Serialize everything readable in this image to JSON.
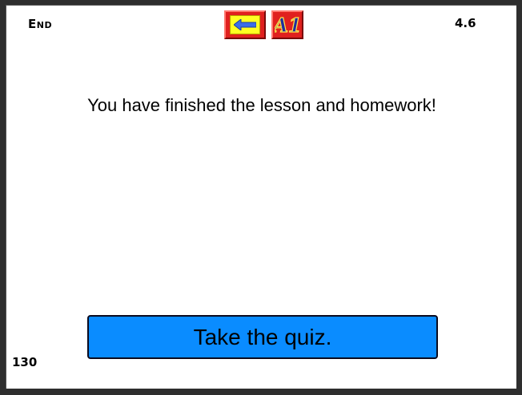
{
  "header": {
    "section_label": "End",
    "version": "4.6"
  },
  "toolbar": {
    "back_icon": "arrow-left-icon",
    "a1_label": "A1"
  },
  "main": {
    "message": "You have finished the lesson and homework!",
    "quiz_button_label": "Take the quiz."
  },
  "footer": {
    "page_number": "130"
  },
  "colors": {
    "quiz_button": "#0a8cff",
    "toolbar_button": "#e0201e",
    "back_inner": "#ffff22",
    "arrow": "#3a6ee8"
  }
}
